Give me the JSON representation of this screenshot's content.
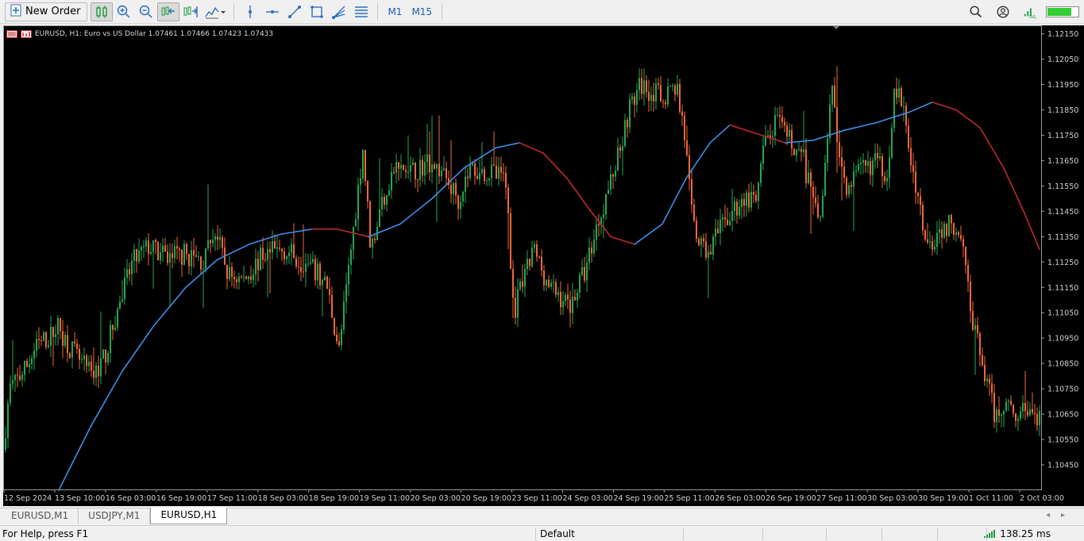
{
  "toolbar": {
    "new_order_label": "New Order",
    "timeframes": [
      "M1",
      "M15"
    ]
  },
  "chart": {
    "symbol_line": "EURUSD, H1:  Euro vs US Dollar  1.07461 1.07466 1.07423 1.07433",
    "price_axis": [
      "1.12150",
      "1.12050",
      "1.11950",
      "1.11850",
      "1.11750",
      "1.11650",
      "1.11550",
      "1.11450",
      "1.11350",
      "1.11250",
      "1.11150",
      "1.11050",
      "1.10950",
      "1.10850",
      "1.10750",
      "1.10650",
      "1.10550",
      "1.10450"
    ],
    "time_axis": [
      "12 Sep 2024",
      "13 Sep 10:00",
      "16 Sep 03:00",
      "16 Sep 19:00",
      "17 Sep 11:00",
      "18 Sep 03:00",
      "18 Sep 19:00",
      "19 Sep 11:00",
      "20 Sep 03:00",
      "20 Sep 19:00",
      "23 Sep 11:00",
      "24 Sep 03:00",
      "24 Sep 19:00",
      "25 Sep 11:00",
      "26 Sep 03:00",
      "26 Sep 19:00",
      "27 Sep 11:00",
      "30 Sep 03:00",
      "30 Sep 19:00",
      "1 Oct 11:00",
      "2 Oct 03:00"
    ],
    "bull_color": "#26a657",
    "bear_color": "#f06a35",
    "ma_up_color": "#3d8fe8",
    "ma_down_color": "#c0282d"
  },
  "chart_data": {
    "type": "candlestick",
    "ylim": [
      1.1035,
      1.1218
    ],
    "price_path": [
      [
        0,
        1.1045
      ],
      [
        10,
        1.1075
      ],
      [
        28,
        1.1082
      ],
      [
        45,
        1.1092
      ],
      [
        62,
        1.1096
      ],
      [
        70,
        1.11
      ],
      [
        85,
        1.1092
      ],
      [
        100,
        1.1085
      ],
      [
        115,
        1.108
      ],
      [
        130,
        1.1088
      ],
      [
        150,
        1.111
      ],
      [
        165,
        1.1125
      ],
      [
        185,
        1.1131
      ],
      [
        205,
        1.1127
      ],
      [
        230,
        1.1128
      ],
      [
        255,
        1.1125
      ],
      [
        268,
        1.1138
      ],
      [
        285,
        1.112
      ],
      [
        305,
        1.1118
      ],
      [
        330,
        1.1128
      ],
      [
        355,
        1.113
      ],
      [
        380,
        1.1125
      ],
      [
        398,
        1.112
      ],
      [
        410,
        1.1115
      ],
      [
        425,
        1.109
      ],
      [
        440,
        1.113
      ],
      [
        455,
        1.117
      ],
      [
        465,
        1.113
      ],
      [
        480,
        1.115
      ],
      [
        495,
        1.1162
      ],
      [
        515,
        1.116
      ],
      [
        540,
        1.1165
      ],
      [
        560,
        1.1158
      ],
      [
        575,
        1.115
      ],
      [
        590,
        1.1162
      ],
      [
        615,
        1.116
      ],
      [
        635,
        1.1158
      ],
      [
        645,
        1.1105
      ],
      [
        660,
        1.112
      ],
      [
        670,
        1.113
      ],
      [
        690,
        1.1115
      ],
      [
        715,
        1.1108
      ],
      [
        735,
        1.1122
      ],
      [
        750,
        1.114
      ],
      [
        770,
        1.116
      ],
      [
        790,
        1.1185
      ],
      [
        805,
        1.1195
      ],
      [
        830,
        1.119
      ],
      [
        850,
        1.1195
      ],
      [
        860,
        1.1175
      ],
      [
        870,
        1.114
      ],
      [
        885,
        1.1128
      ],
      [
        900,
        1.1135
      ],
      [
        920,
        1.1145
      ],
      [
        935,
        1.115
      ],
      [
        950,
        1.1148
      ],
      [
        960,
        1.117
      ],
      [
        975,
        1.118
      ],
      [
        995,
        1.1172
      ],
      [
        1010,
        1.1165
      ],
      [
        1020,
        1.115
      ],
      [
        1030,
        1.114
      ],
      [
        1045,
        1.1195
      ],
      [
        1055,
        1.1165
      ],
      [
        1065,
        1.1155
      ],
      [
        1080,
        1.116
      ],
      [
        1100,
        1.1165
      ],
      [
        1115,
        1.116
      ],
      [
        1125,
        1.1195
      ],
      [
        1135,
        1.1185
      ],
      [
        1145,
        1.1165
      ],
      [
        1155,
        1.115
      ],
      [
        1165,
        1.113
      ],
      [
        1180,
        1.1138
      ],
      [
        1200,
        1.114
      ],
      [
        1212,
        1.1135
      ],
      [
        1220,
        1.1105
      ],
      [
        1235,
        1.1085
      ],
      [
        1250,
        1.1065
      ],
      [
        1265,
        1.107
      ],
      [
        1280,
        1.1065
      ],
      [
        1295,
        1.1068
      ],
      [
        1305,
        1.1062
      ]
    ],
    "moving_average": [
      [
        70,
        1.1035
      ],
      [
        110,
        1.106
      ],
      [
        150,
        1.1082
      ],
      [
        190,
        1.11
      ],
      [
        230,
        1.1115
      ],
      [
        270,
        1.1126
      ],
      [
        310,
        1.1132
      ],
      [
        350,
        1.1136
      ],
      [
        390,
        1.1138
      ],
      [
        420,
        1.1138
      ],
      [
        460,
        1.1135
      ],
      [
        500,
        1.114
      ],
      [
        540,
        1.115
      ],
      [
        580,
        1.1162
      ],
      [
        620,
        1.117
      ],
      [
        650,
        1.1172
      ],
      [
        680,
        1.1168
      ],
      [
        710,
        1.1158
      ],
      [
        740,
        1.1145
      ],
      [
        765,
        1.1135
      ],
      [
        795,
        1.1132
      ],
      [
        830,
        1.114
      ],
      [
        860,
        1.1158
      ],
      [
        890,
        1.1172
      ],
      [
        915,
        1.1179
      ],
      [
        945,
        1.1176
      ],
      [
        985,
        1.1172
      ],
      [
        1020,
        1.1173
      ],
      [
        1060,
        1.1177
      ],
      [
        1100,
        1.118
      ],
      [
        1140,
        1.1184
      ],
      [
        1170,
        1.1188
      ],
      [
        1200,
        1.1185
      ],
      [
        1230,
        1.1178
      ],
      [
        1260,
        1.1162
      ],
      [
        1285,
        1.1145
      ],
      [
        1305,
        1.113
      ]
    ],
    "ma_color_breaks": [
      [
        0,
        "up"
      ],
      [
        400,
        "down"
      ],
      [
        465,
        "up"
      ],
      [
        640,
        "down"
      ],
      [
        800,
        "up"
      ],
      [
        915,
        "down"
      ],
      [
        990,
        "up"
      ],
      [
        1170,
        "down"
      ]
    ]
  },
  "tabs": [
    "EURUSD,M1",
    "USDJPY,M1",
    "EURUSD,H1"
  ],
  "active_tab": 2,
  "status": {
    "help": "For Help, press F1",
    "profile": "Default",
    "ping": "138.25 ms"
  }
}
